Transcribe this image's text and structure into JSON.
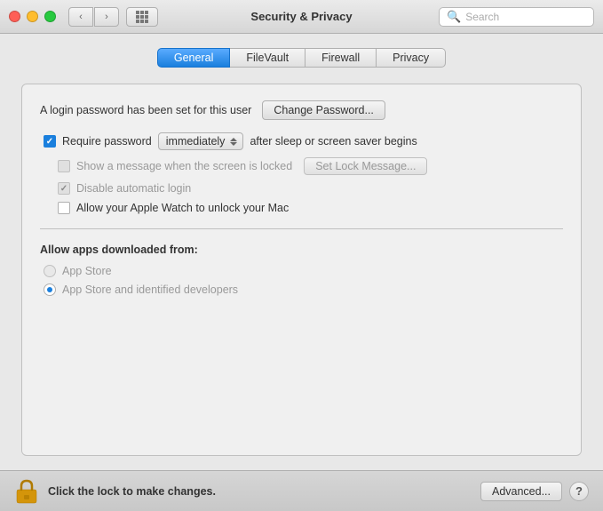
{
  "titlebar": {
    "title": "Security & Privacy",
    "back_button": "‹",
    "forward_button": "›",
    "search_placeholder": "Search"
  },
  "tabs": [
    {
      "id": "general",
      "label": "General",
      "active": true
    },
    {
      "id": "filevault",
      "label": "FileVault",
      "active": false
    },
    {
      "id": "firewall",
      "label": "Firewall",
      "active": false
    },
    {
      "id": "privacy",
      "label": "Privacy",
      "active": false
    }
  ],
  "general": {
    "login_password_text": "A login password has been set for this user",
    "change_password_label": "Change Password...",
    "require_password_label": "Require password",
    "require_password_checked": true,
    "dropdown_value": "immediately",
    "after_sleep_text": "after sleep or screen saver begins",
    "show_message_label": "Show a message when the screen is locked",
    "show_message_checked": false,
    "show_message_disabled": true,
    "set_lock_message_label": "Set Lock Message...",
    "disable_autologin_label": "Disable automatic login",
    "disable_autologin_checked": true,
    "disable_autologin_disabled": true,
    "apple_watch_label": "Allow your Apple Watch to unlock your Mac",
    "apple_watch_checked": false,
    "download_section_label": "Allow apps downloaded from:",
    "app_store_label": "App Store",
    "app_store_selected": false,
    "app_store_identified_label": "App Store and identified developers",
    "app_store_identified_selected": true
  },
  "bottom": {
    "lock_text": "Click the lock to make changes.",
    "advanced_label": "Advanced...",
    "help_label": "?"
  }
}
